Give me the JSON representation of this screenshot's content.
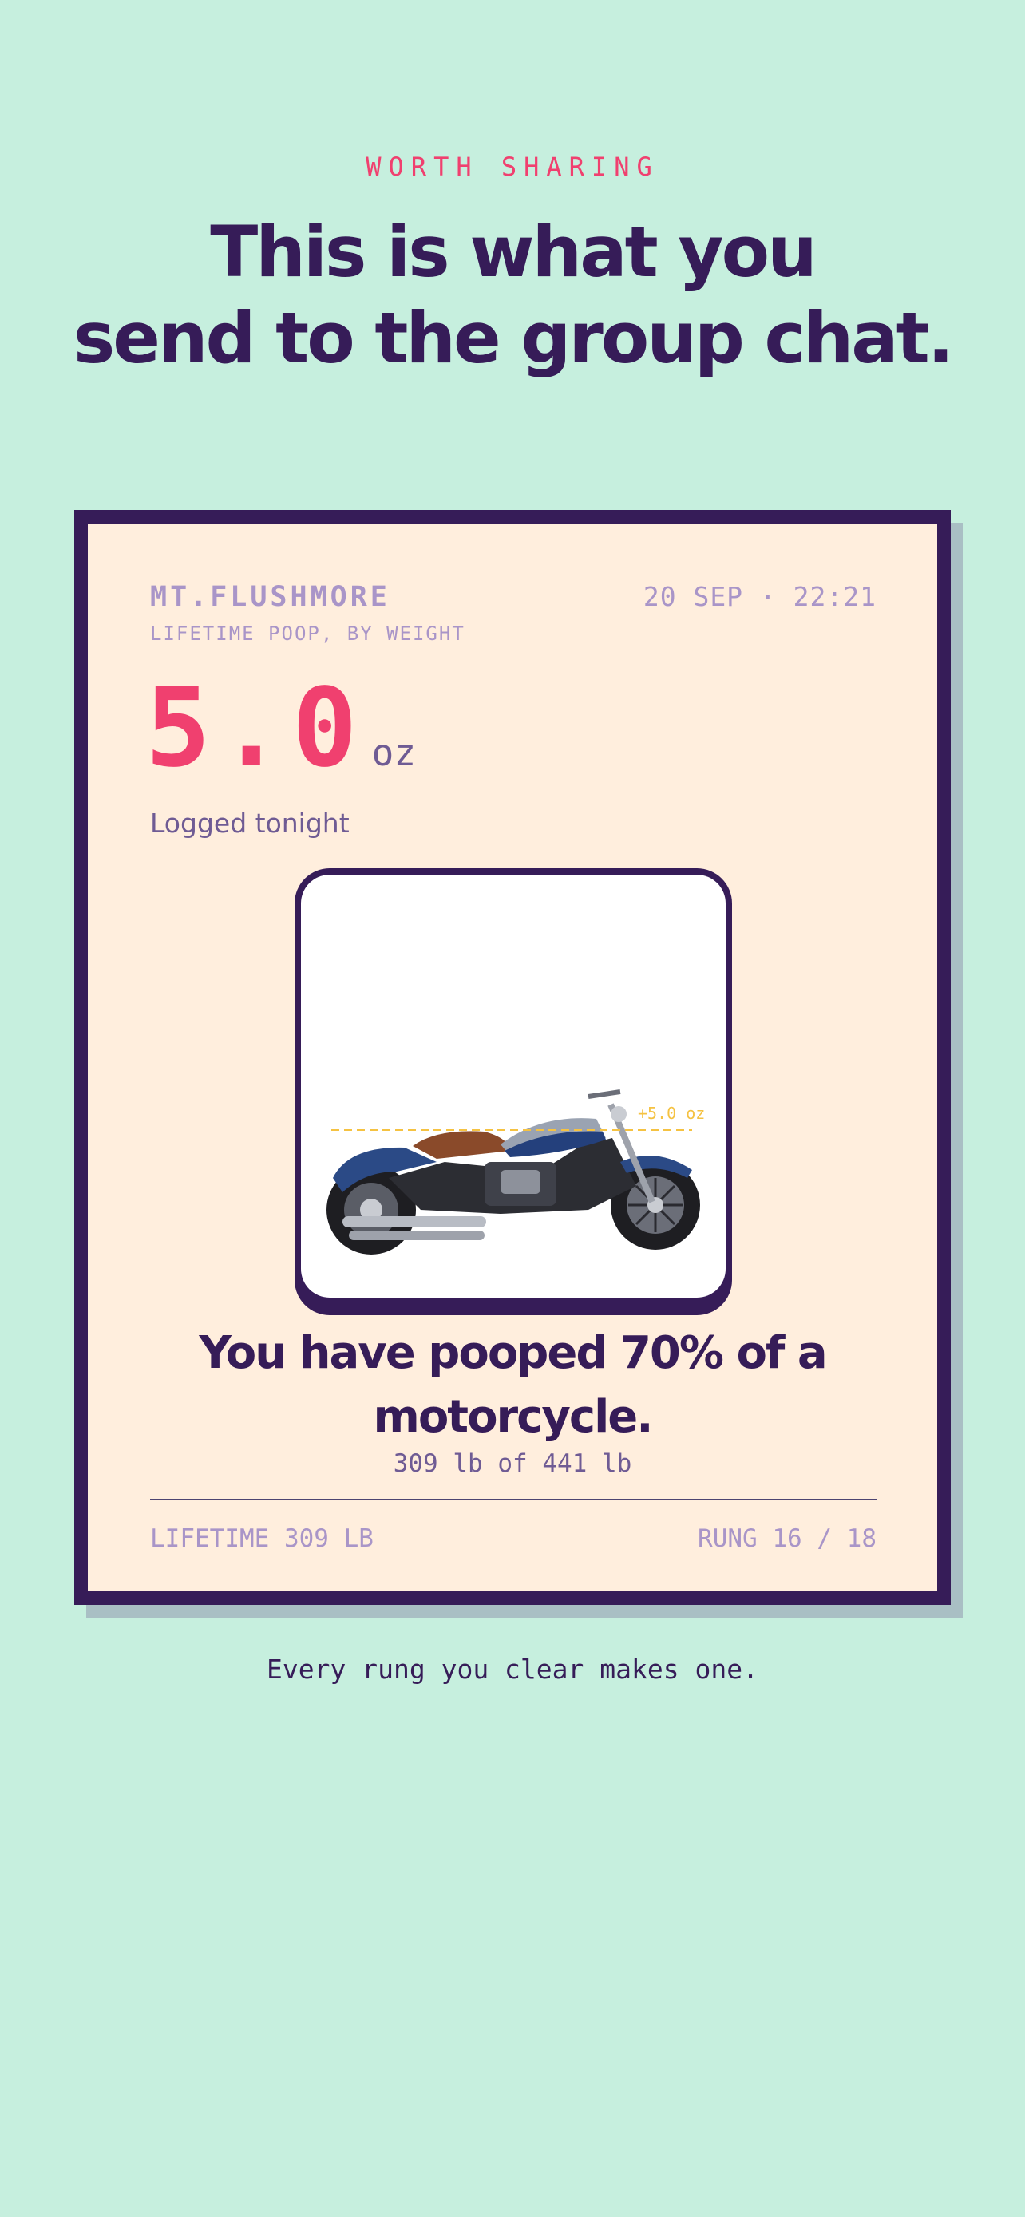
{
  "page": {
    "eyebrow": "WORTH SHARING",
    "headline_line1": "This is what you",
    "headline_line2": "send to the group chat.",
    "tagline": "Every rung you clear makes one."
  },
  "card": {
    "brand": "MT.FLUSHMORE",
    "timestamp": "20 SEP · 22:21",
    "subtitle": "LIFETIME POOP, BY WEIGHT",
    "amount_value": "5.0",
    "amount_unit": "oz",
    "logged_label": "Logged tonight",
    "image": {
      "subject": "motorcycle",
      "marker_label": "+5.0 oz",
      "fill_fraction": 0.7
    },
    "achievement_line1": "You have pooped 70% of a",
    "achievement_line2": "motorcycle.",
    "progress_text": "309 lb of 441 lb",
    "footer_left": "LIFETIME 309 LB",
    "footer_right": "RUNG 16 / 18"
  },
  "colors": {
    "background": "#c6efde",
    "card": "#ffeedd",
    "ink": "#361c58",
    "accent": "#f0406f",
    "muted": "#a995c8",
    "marker": "#f5c242"
  }
}
